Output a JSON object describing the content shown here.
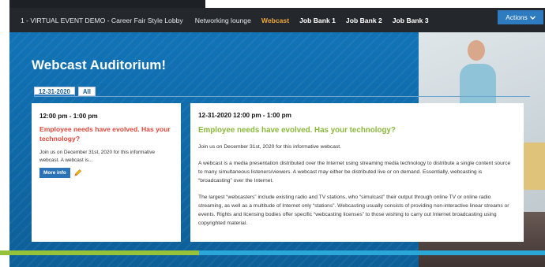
{
  "nav": {
    "event_title": "1 - VIRTUAL EVENT DEMO - Career Fair Style Lobby",
    "items": [
      {
        "label": "Networking lounge"
      },
      {
        "label": "Webcast"
      },
      {
        "label": "Job Bank 1"
      },
      {
        "label": "Job Bank 2"
      },
      {
        "label": "Job Bank 3"
      }
    ],
    "actions_label": "Actions",
    "actions_icon": "chevron-down-icon"
  },
  "hero": {
    "title": "Webcast Auditorium!"
  },
  "tabs": [
    {
      "label": "12-31-2020"
    },
    {
      "label": "All"
    }
  ],
  "event_card": {
    "time": "12:00 pm - 1:00 pm",
    "title": "Employee needs have evolved. Has your technology?",
    "description": "Join us on December 31st, 2020 for this informative webcast. A webcast is...",
    "more_label": "More info",
    "edit_icon": "pencil-icon"
  },
  "detail": {
    "date_time": "12-31-2020   12:00 pm - 1:00 pm",
    "title": "Employee needs have evolved. Has your technology?",
    "paragraphs": [
      "Join us on December 31st, 2020 for this informative webcast.",
      "A webcast is a media presentation distributed over the Internet using streaming media technology to distribute a single content source to many simultaneous listeners/viewers. A webcast may either be distributed live or on demand. Essentially, webcasting is “broadcasting” over the Internet.",
      "The largest “webcasters” include existing radio and TV stations, who “simulcast” their output through online TV or online radio streaming, as well as a multitude of Internet only “stations”. Webcasting usually consists of providing non-interactive linear streams or events. Rights and licensing bodies offer specific “webcasting licenses” to those wishing to carry out Internet broadcasting using copyrighted material."
    ]
  },
  "colors": {
    "nav_bg": "#24282c",
    "active_nav": "#f0a63a",
    "hero_blue": "#1173b6",
    "title_red": "#e2473b",
    "title_green": "#8ab83d",
    "button_blue": "#2a73b6",
    "stripe_green": "#95c13b",
    "stripe_blue": "#2aa7d6"
  }
}
